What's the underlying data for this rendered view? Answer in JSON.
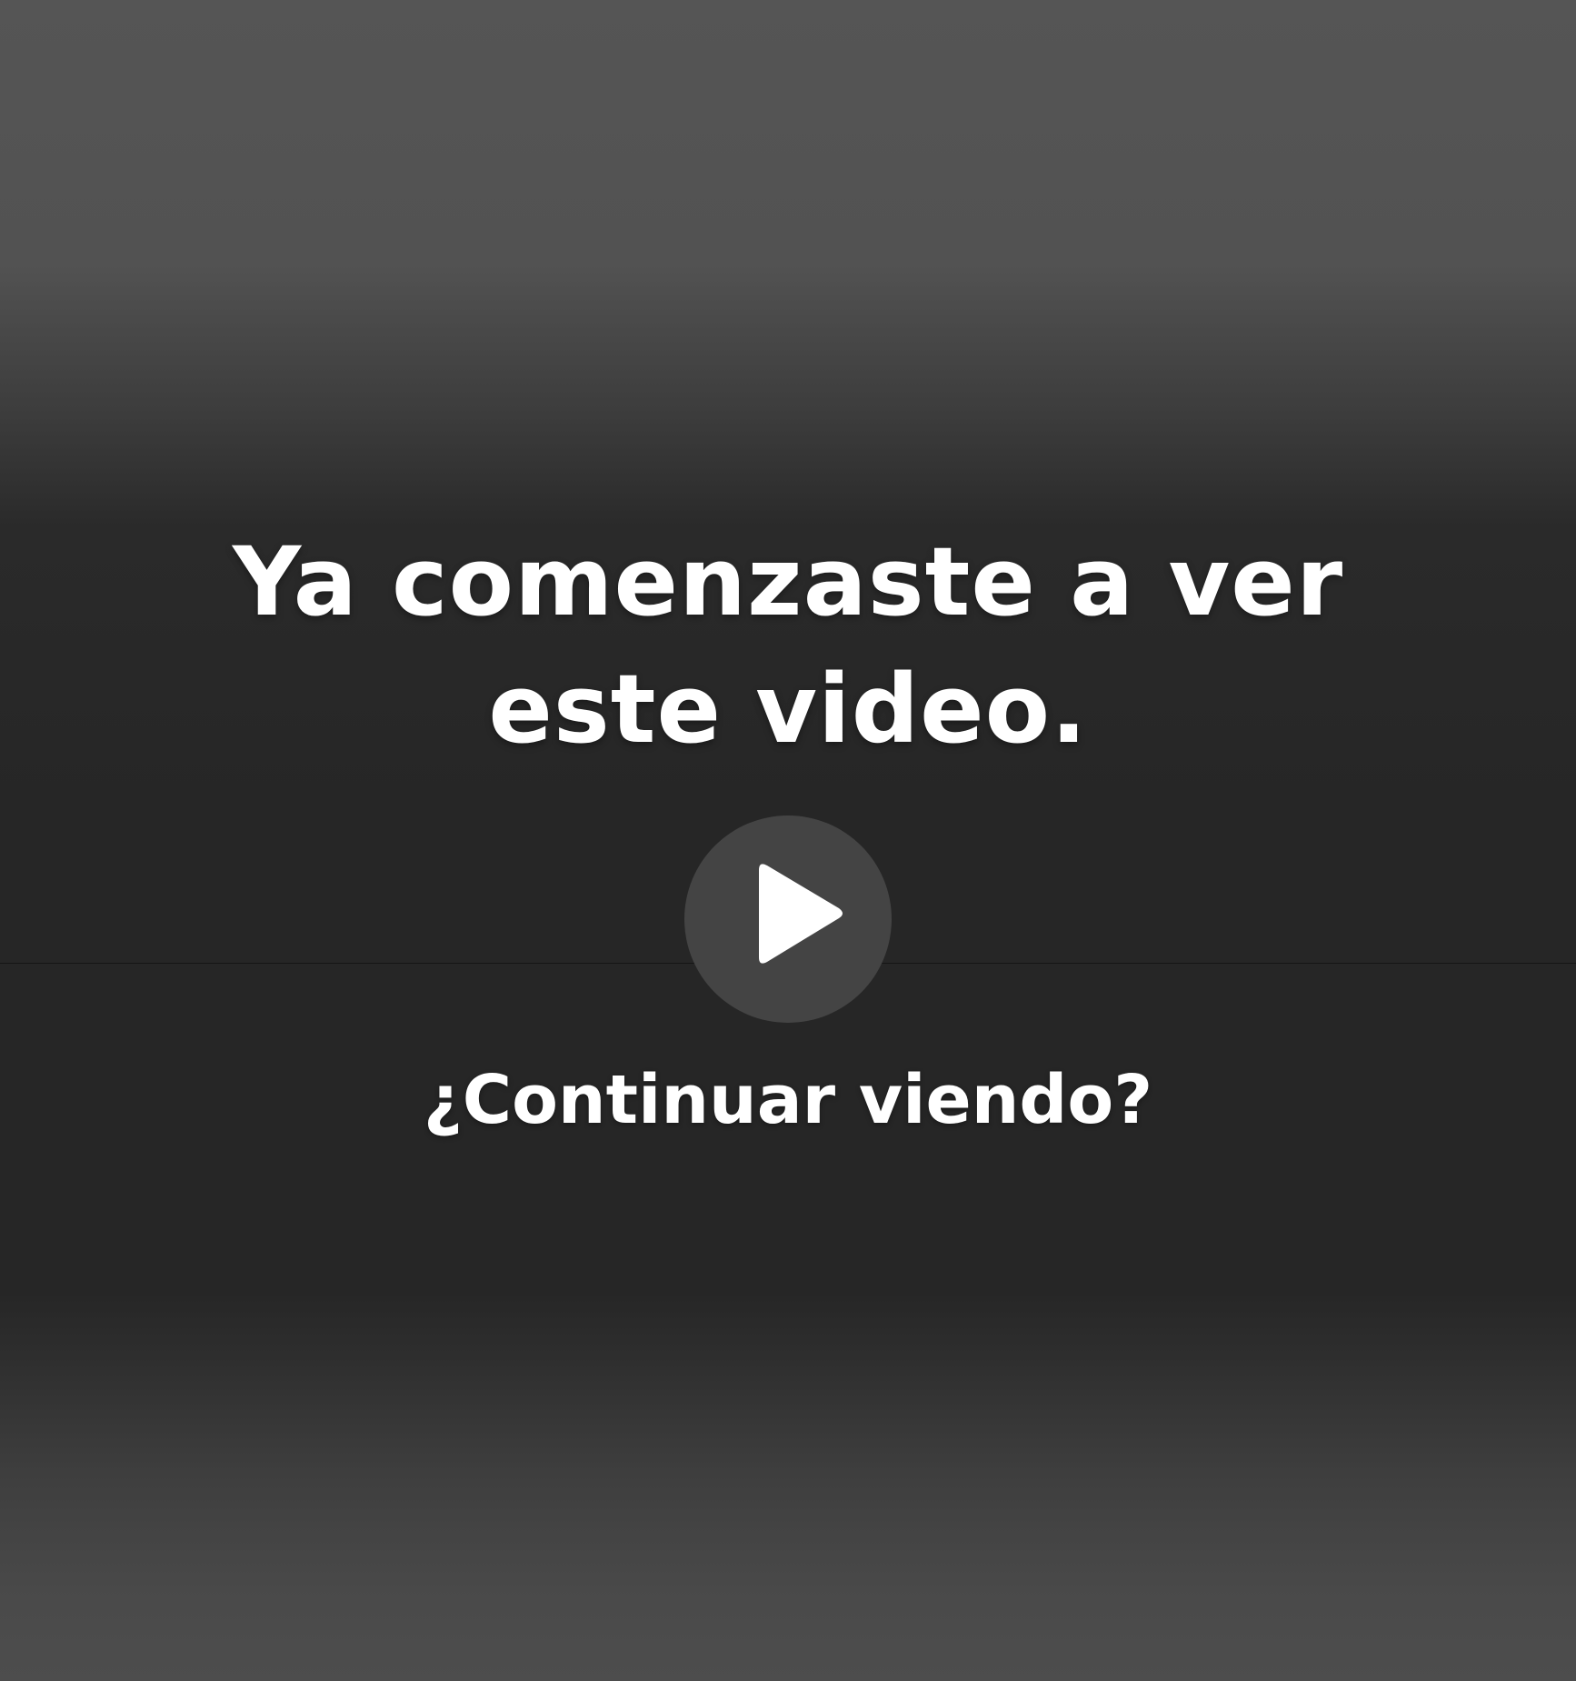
{
  "resume_overlay": {
    "headline": "Ya comenzaste a ver este video.",
    "play_icon": "play-icon",
    "prompt": "¿Continuar viendo?"
  },
  "colors": {
    "text": "#ffffff",
    "play_button_bg": "#444444",
    "background_dark": "#262626",
    "background_light": "#555555"
  }
}
